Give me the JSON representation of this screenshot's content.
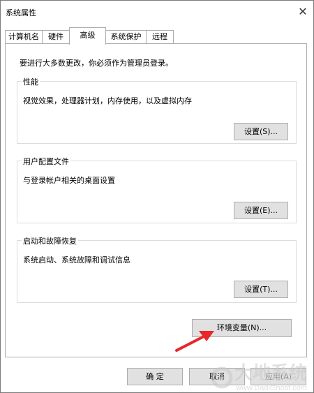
{
  "window": {
    "title": "系统属性",
    "close_glyph": "✕"
  },
  "tabs": [
    {
      "label": "计算机名"
    },
    {
      "label": "硬件"
    },
    {
      "label": "高级"
    },
    {
      "label": "系统保护"
    },
    {
      "label": "远程"
    }
  ],
  "panel": {
    "admin_note": "要进行大多数更改，你必须作为管理员登录。",
    "performance": {
      "title": "性能",
      "description": "视觉效果，处理器计划，内存使用，以及虚拟内存",
      "button": "设置(S)..."
    },
    "user_profiles": {
      "title": "用户配置文件",
      "description": "与登录帐户相关的桌面设置",
      "button": "设置(E)..."
    },
    "startup_recovery": {
      "title": "启动和故障恢复",
      "description": "系统启动、系统故障和调试信息",
      "button": "设置(T)..."
    },
    "env_button": "环境变量(N)..."
  },
  "footer": {
    "ok": "确 定",
    "cancel": "取消",
    "apply": "应用(A)"
  },
  "colors": {
    "annotation_arrow": "#e8262b",
    "button_face": "#e1e1e1",
    "border": "#adadad"
  },
  "watermark": {
    "logo_text": "大地系统",
    "url": "www.DadiGhost.com"
  }
}
